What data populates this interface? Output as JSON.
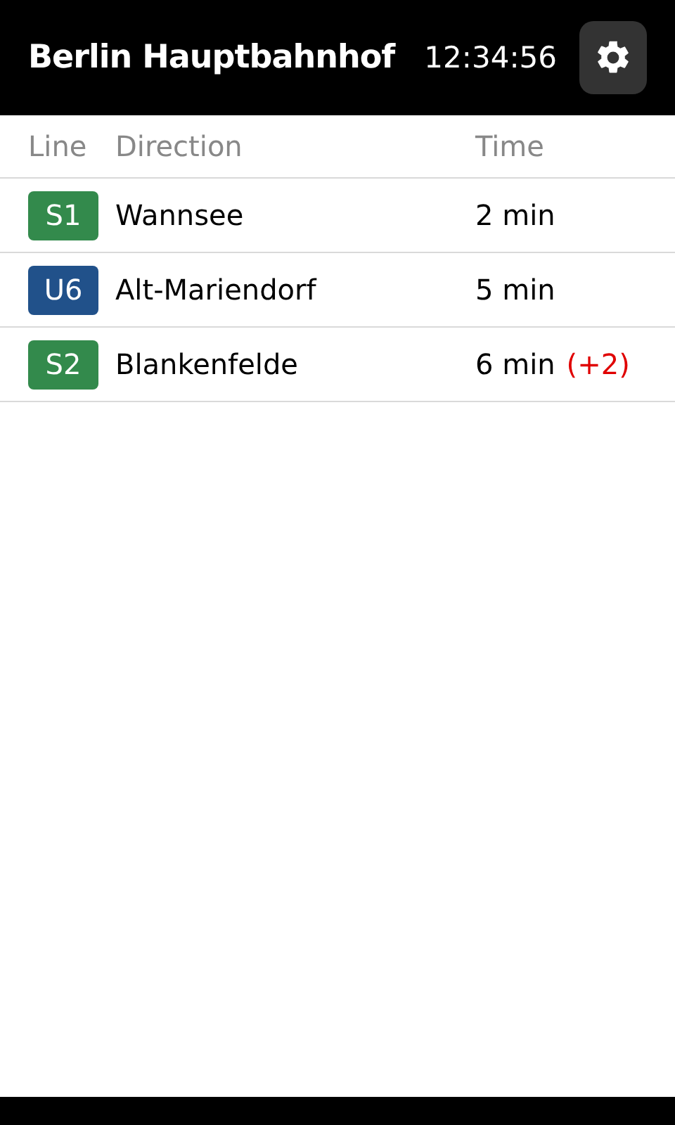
{
  "header": {
    "title": "Berlin Hauptbahnhof",
    "clock": "12:34:56"
  },
  "table": {
    "columns": [
      "Line",
      "Direction",
      "Time"
    ],
    "rows": [
      {
        "line": "S1",
        "color": "#338a4c",
        "direction": "Wannsee",
        "time": "2 min"
      },
      {
        "line": "U6",
        "color": "#21518a",
        "direction": "Alt-Mariendorf",
        "time": "5 min"
      },
      {
        "line": "S2",
        "color": "#338a4c",
        "direction": "Blankenfelde",
        "time": "6 min",
        "delay": "(+2)"
      }
    ]
  }
}
